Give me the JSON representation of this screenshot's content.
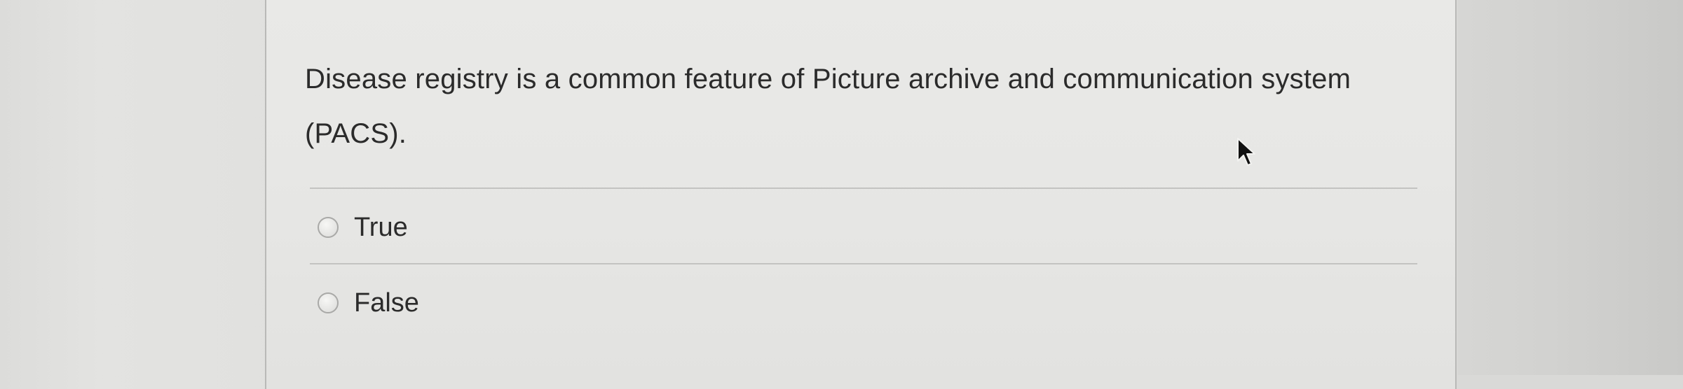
{
  "question": {
    "text": "Disease registry is a common feature of Picture archive and communication system (PACS)."
  },
  "options": [
    {
      "label": "True",
      "selected": false
    },
    {
      "label": "False",
      "selected": false
    }
  ],
  "icons": {
    "cursor": "mouse-pointer-icon",
    "radio": "radio-unchecked-icon"
  },
  "colors": {
    "text": "#2b2b2b",
    "card_background": "#e8e8e6",
    "divider": "#c3c3c1"
  }
}
